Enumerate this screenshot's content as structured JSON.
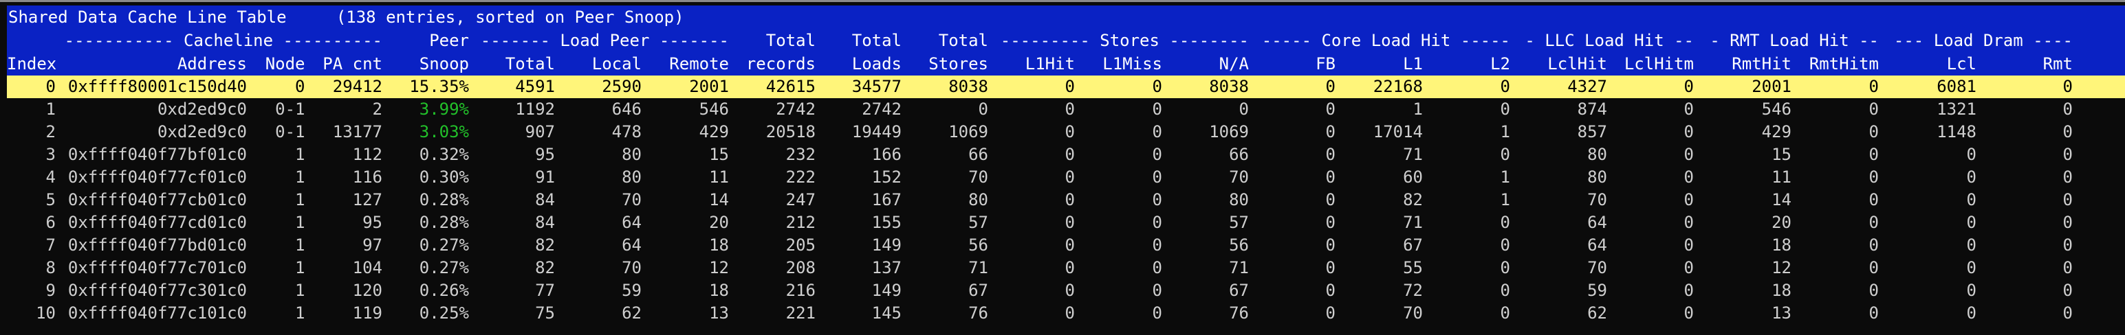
{
  "title": "Shared Data Cache Line Table     (138 entries, sorted on Peer Snoop)",
  "colors": {
    "header_bg": "#0a22c4",
    "selected_bg": "#fff57a",
    "highlight": "#22c02a",
    "text": "#cfcfcf"
  },
  "group_headers": {
    "cacheline": "----------- Cacheline ----------",
    "peer": "Peer",
    "load_peer": "------- Load Peer -------",
    "total_records": "Total",
    "total_loads": "Total",
    "total_stores": "Total",
    "stores": "--------- Stores --------",
    "core_load_hit": "----- Core Load Hit -----",
    "llc_load_hit": "- LLC Load Hit --",
    "rmt_load_hit": "- RMT Load Hit --",
    "load_dram": "--- Load Dram ----"
  },
  "columns": [
    "Index",
    "Address",
    "Node",
    "PA cnt",
    "Snoop",
    "Total",
    "Local",
    "Remote",
    "records",
    "Loads",
    "Stores",
    "L1Hit",
    "L1Miss",
    "N/A",
    "FB",
    "L1",
    "L2",
    "LclHit",
    "LclHitm",
    "RmtHit",
    "RmtHitm",
    "Lcl",
    "Rmt"
  ],
  "selected_row": 0,
  "highlighted_snoop_rows": [
    1,
    2
  ],
  "rows": [
    [
      "0",
      "0xffff80001c150d40",
      "0",
      "29412",
      "15.35%",
      "4591",
      "2590",
      "2001",
      "42615",
      "34577",
      "8038",
      "0",
      "0",
      "8038",
      "0",
      "22168",
      "0",
      "4327",
      "0",
      "2001",
      "0",
      "6081",
      "0"
    ],
    [
      "1",
      "0xd2ed9c0",
      "0-1",
      "2",
      "3.99%",
      "1192",
      "646",
      "546",
      "2742",
      "2742",
      "0",
      "0",
      "0",
      "0",
      "0",
      "1",
      "0",
      "874",
      "0",
      "546",
      "0",
      "1321",
      "0"
    ],
    [
      "2",
      "0xd2ed9c0",
      "0-1",
      "13177",
      "3.03%",
      "907",
      "478",
      "429",
      "20518",
      "19449",
      "1069",
      "0",
      "0",
      "1069",
      "0",
      "17014",
      "1",
      "857",
      "0",
      "429",
      "0",
      "1148",
      "0"
    ],
    [
      "3",
      "0xffff040f77bf01c0",
      "1",
      "112",
      "0.32%",
      "95",
      "80",
      "15",
      "232",
      "166",
      "66",
      "0",
      "0",
      "66",
      "0",
      "71",
      "0",
      "80",
      "0",
      "15",
      "0",
      "0",
      "0"
    ],
    [
      "4",
      "0xffff040f77cf01c0",
      "1",
      "116",
      "0.30%",
      "91",
      "80",
      "11",
      "222",
      "152",
      "70",
      "0",
      "0",
      "70",
      "0",
      "60",
      "1",
      "80",
      "0",
      "11",
      "0",
      "0",
      "0"
    ],
    [
      "5",
      "0xffff040f77cb01c0",
      "1",
      "127",
      "0.28%",
      "84",
      "70",
      "14",
      "247",
      "167",
      "80",
      "0",
      "0",
      "80",
      "0",
      "82",
      "1",
      "70",
      "0",
      "14",
      "0",
      "0",
      "0"
    ],
    [
      "6",
      "0xffff040f77cd01c0",
      "1",
      "95",
      "0.28%",
      "84",
      "64",
      "20",
      "212",
      "155",
      "57",
      "0",
      "0",
      "57",
      "0",
      "71",
      "0",
      "64",
      "0",
      "20",
      "0",
      "0",
      "0"
    ],
    [
      "7",
      "0xffff040f77bd01c0",
      "1",
      "97",
      "0.27%",
      "82",
      "64",
      "18",
      "205",
      "149",
      "56",
      "0",
      "0",
      "56",
      "0",
      "67",
      "0",
      "64",
      "0",
      "18",
      "0",
      "0",
      "0"
    ],
    [
      "8",
      "0xffff040f77c701c0",
      "1",
      "104",
      "0.27%",
      "82",
      "70",
      "12",
      "208",
      "137",
      "71",
      "0",
      "0",
      "71",
      "0",
      "55",
      "0",
      "70",
      "0",
      "12",
      "0",
      "0",
      "0"
    ],
    [
      "9",
      "0xffff040f77c301c0",
      "1",
      "120",
      "0.26%",
      "77",
      "59",
      "18",
      "216",
      "149",
      "67",
      "0",
      "0",
      "67",
      "0",
      "72",
      "0",
      "59",
      "0",
      "18",
      "0",
      "0",
      "0"
    ],
    [
      "10",
      "0xffff040f77c101c0",
      "1",
      "119",
      "0.25%",
      "75",
      "62",
      "13",
      "221",
      "145",
      "76",
      "0",
      "0",
      "76",
      "0",
      "70",
      "0",
      "62",
      "0",
      "13",
      "0",
      "0",
      "0"
    ]
  ]
}
